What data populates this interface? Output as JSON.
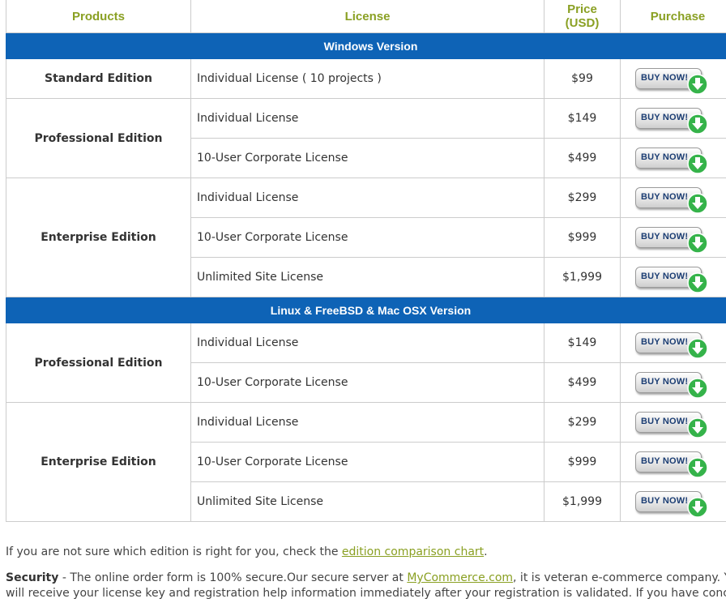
{
  "header": {
    "products": "Products",
    "license": "License",
    "price_line1": "Price",
    "price_line2": "(USD)",
    "purchase": "Purchase"
  },
  "buy_button_label": "BUY NOW!",
  "colors": {
    "section_bar": "#0e63b6",
    "header_text": "#8aa023",
    "link": "#8aa023",
    "buy_arrow": "#35b34a"
  },
  "sections": [
    {
      "title": "Windows Version",
      "groups": [
        {
          "product": "Standard Edition",
          "rows": [
            {
              "license": "Individual License ( 10 projects )",
              "price": "$99"
            }
          ]
        },
        {
          "product": "Professional Edition",
          "rows": [
            {
              "license": "Individual License",
              "price": "$149"
            },
            {
              "license": "10-User Corporate License",
              "price": "$499"
            }
          ]
        },
        {
          "product": "Enterprise Edition",
          "rows": [
            {
              "license": "Individual License",
              "price": "$299"
            },
            {
              "license": "10-User Corporate License",
              "price": "$999"
            },
            {
              "license": "Unlimited Site License",
              "price": "$1,999"
            }
          ]
        }
      ]
    },
    {
      "title": "Linux & FreeBSD & Mac OSX Version",
      "groups": [
        {
          "product": "Professional Edition",
          "rows": [
            {
              "license": "Individual License",
              "price": "$149"
            },
            {
              "license": "10-User Corporate License",
              "price": "$499"
            }
          ]
        },
        {
          "product": "Enterprise Edition",
          "rows": [
            {
              "license": "Individual License",
              "price": "$299"
            },
            {
              "license": "10-User Corporate License",
              "price": "$999"
            },
            {
              "license": "Unlimited Site License",
              "price": "$1,999"
            }
          ]
        }
      ]
    }
  ],
  "notes": {
    "comparison_prefix": "If you are not sure which edition is right for you, check the ",
    "comparison_link": "edition comparison chart",
    "comparison_suffix": ".",
    "security_label": "Security",
    "security_text_1": " - The online order form is 100% secure.Our secure server at ",
    "security_link": "MyCommerce.com",
    "security_text_2": ", it is veteran e-commerce company. You",
    "security_line2": "will receive your license key and registration help information immediately after your registration is validated. If you have concerns"
  }
}
